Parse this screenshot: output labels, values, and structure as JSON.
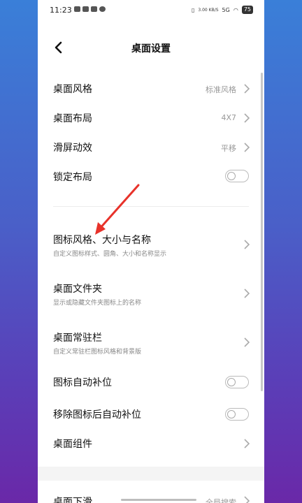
{
  "status_bar": {
    "time": "11:23",
    "net_speed": "3.00 KB/S",
    "network": "5G",
    "battery": "75"
  },
  "header": {
    "title": "桌面设置"
  },
  "settings": {
    "desktop_style": {
      "label": "桌面风格",
      "value": "标准风格"
    },
    "desktop_layout": {
      "label": "桌面布局",
      "value": "4X7"
    },
    "scroll_effect": {
      "label": "滑屏动效",
      "value": "平移"
    },
    "lock_layout": {
      "label": "锁定布局",
      "enabled": false
    },
    "icon_style": {
      "label": "图标风格、大小与名称",
      "sub": "自定义图标样式、圆角、大小和名称显示"
    },
    "desktop_folder": {
      "label": "桌面文件夹",
      "sub": "显示或隐藏文件夹图标上的名称"
    },
    "dock": {
      "label": "桌面常驻栏",
      "sub": "自定义常驻栏图标风格和背景版"
    },
    "auto_fill": {
      "label": "图标自动补位",
      "enabled": false
    },
    "auto_fill_after_remove": {
      "label": "移除图标后自动补位",
      "enabled": false
    },
    "widgets": {
      "label": "桌面组件"
    },
    "swipe_down": {
      "label": "桌面下滑",
      "value": "全局搜索"
    }
  },
  "colors": {
    "annotation_arrow": "#e8322a",
    "background_top": "#3a7fd8",
    "background_bottom": "#6a28a8"
  }
}
